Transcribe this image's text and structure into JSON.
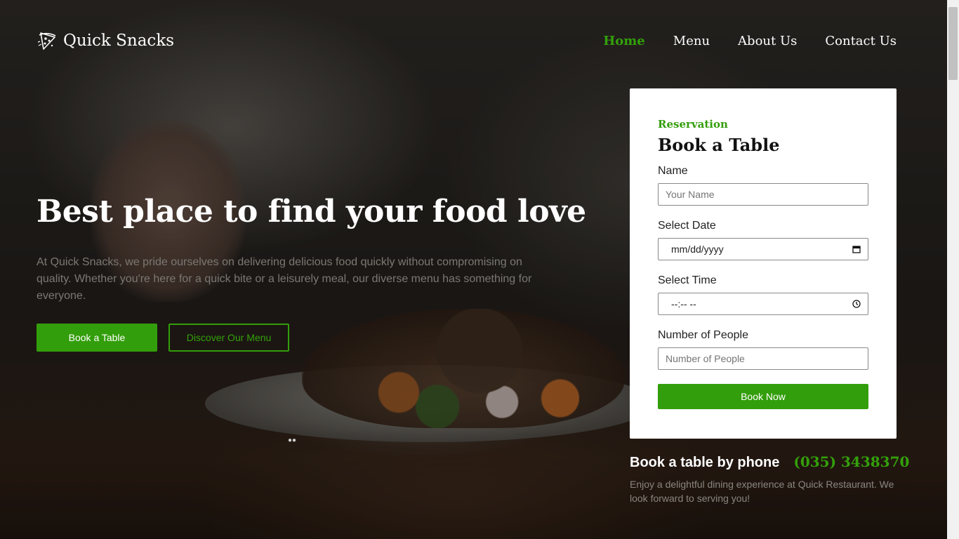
{
  "brand": {
    "name": "Quick Snacks",
    "icon": "pizza-logo-icon"
  },
  "nav": {
    "items": [
      {
        "label": "Home",
        "active": true
      },
      {
        "label": "Menu",
        "active": false
      },
      {
        "label": "About Us",
        "active": false
      },
      {
        "label": "Contact Us",
        "active": false
      }
    ]
  },
  "hero": {
    "headline": "Best place to find your food love",
    "intro": "At Quick Snacks, we pride ourselves on delivering delicious food quickly without compromising on quality. Whether you're here for a quick bite or a leisurely meal, our diverse menu has something for everyone.",
    "primary_button": "Book a Table",
    "secondary_button": "Discover Our Menu"
  },
  "reservation": {
    "eyebrow": "Reservation",
    "title": "Book a Table",
    "fields": {
      "name": {
        "label": "Name",
        "placeholder": "Your Name"
      },
      "date": {
        "label": "Select Date",
        "value": "mm/dd/yyyy",
        "icon": "calendar-icon"
      },
      "time": {
        "label": "Select Time",
        "value": "--:-- --",
        "icon": "clock-icon"
      },
      "people": {
        "label": "Number of People",
        "placeholder": "Number of People"
      }
    },
    "submit": "Book Now"
  },
  "phone": {
    "label": "Book a table by phone",
    "number": "(035) 3438370",
    "note": "Enjoy a delightful dining experience at Quick Restaurant. We look forward to serving you!"
  },
  "colors": {
    "accent": "#339e0b",
    "accent_text": "#33a00a",
    "card": "#ffffff"
  }
}
